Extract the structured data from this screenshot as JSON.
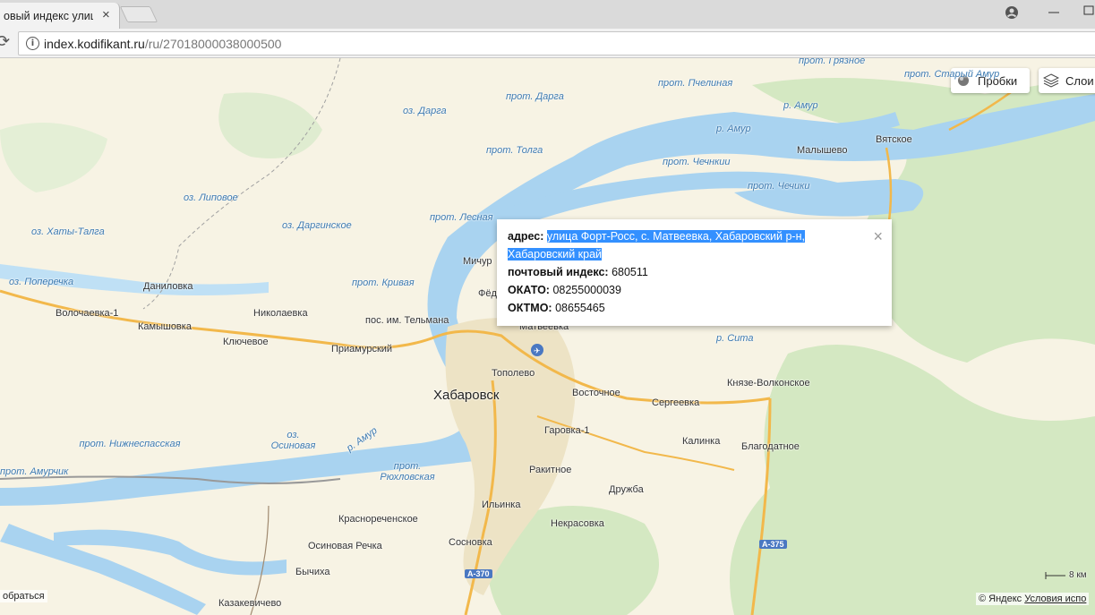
{
  "browser": {
    "tab_title": "овый индекс улиц",
    "tab_close": "×",
    "url_domain": "index.kodifikant.ru",
    "url_path": "/ru/27018000038000500"
  },
  "map": {
    "buttons": {
      "traffic": "Пробки",
      "layers": "Слои"
    },
    "water_labels": [
      "прот. Грязное",
      "прот. Пчелиная",
      "прот. Старый Амур",
      "прот. Дарга",
      "оз. Дарга",
      "р. Амур",
      "р. Амур",
      "прот. Толга",
      "прот. Чечнкии",
      "прот. Чечики",
      "оз. Липовое",
      "прот. Лесная",
      "оз. Хаты-Талга",
      "оз. Даргинское",
      "оз. Поперечка",
      "прот. Кривая",
      "р. Сита",
      "оз. Осиновая",
      "р. Амур",
      "прот. Нижнеспасская",
      "прот. Амурчик",
      "прот. Рюхловская"
    ],
    "place_labels": [
      "Вятское",
      "Малышево",
      "Мичур",
      "Фёд",
      "Даниловка",
      "Николаевка",
      "Волочаевка-1",
      "пос. им. Тельмана",
      "Матвеевка",
      "Камышовка",
      "Ключевое",
      "Приамурский",
      "Тополево",
      "Восточное",
      "Сергеевка",
      "Князе-Волконское",
      "Гаровка-1",
      "Калинка",
      "Благодатное",
      "Ракитное",
      "Дружба",
      "Красноречeнское",
      "Ильинка",
      "Некрасовка",
      "Осиновая Речка",
      "Сосновка",
      "Бычиха",
      "Казакевичево"
    ],
    "city_label": "Хабаровск",
    "road_badges": [
      "А-375",
      "А-370"
    ],
    "scale": "8 км",
    "copyright": "© Яндекс",
    "terms": "Условия испо",
    "report": "обраться"
  },
  "popup": {
    "address_label": "адрес:",
    "address_value": "улица Форт-Росс, с. Матвеевка, Хабаровский р-н,",
    "address_value2": "Хабаровский край",
    "postal_label": "почтовый индекс:",
    "postal_value": "680511",
    "okato_label": "ОКАТО:",
    "okato_value": "08255000039",
    "oktmo_label": "ОКТМО:",
    "oktmo_value": "08655465",
    "close": "×"
  },
  "colors": {
    "water": "#a9d3f0",
    "land": "#f7f3e4",
    "forest": "#d4e8c2",
    "road": "#f2b84b",
    "selection": "#3390ff"
  }
}
